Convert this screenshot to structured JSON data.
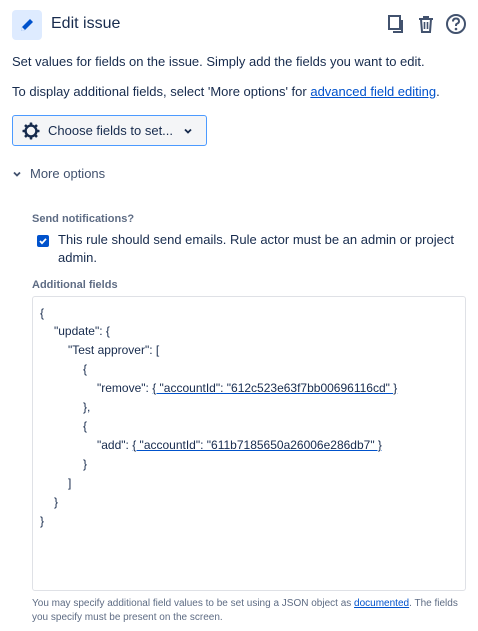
{
  "header": {
    "title": "Edit issue",
    "icons": [
      "pencil-icon",
      "copy-icon",
      "trash-icon",
      "help-icon"
    ]
  },
  "intro": {
    "line1": "Set values for fields on the issue. Simply add the fields you want to edit.",
    "line2_prefix": "To display additional fields, select 'More options' for ",
    "line2_link": "advanced field editing",
    "line2_suffix": "."
  },
  "choose_button": {
    "label": "Choose fields to set..."
  },
  "more_options": {
    "label": "More options"
  },
  "notifications": {
    "label": "Send notifications?",
    "checked": true,
    "text": "This rule should send emails. Rule actor must be an admin or project admin."
  },
  "additional_fields": {
    "label": "Additional fields",
    "json_lines": {
      "l1": "{",
      "l2": "\"update\": {",
      "l3": "\"Test approver\": [",
      "l4": "{",
      "l5_key": "\"remove\": ",
      "l5_val": "{ \"accountId\": \"612c523e63f7bb00696116cd\" }",
      "l6": "},",
      "l7": "{",
      "l8_key": "\"add\": ",
      "l8_val": "{ \"accountId\": \"611b7185650a26006e286db7\" }",
      "l9": "}",
      "l10": "]",
      "l11": "}",
      "l12": "}"
    }
  },
  "hint": {
    "prefix": "You may specify additional field values to be set using a JSON object as ",
    "link": "documented",
    "suffix": ". The fields you specify must be present on the screen."
  },
  "colors": {
    "accent": "#0052cc",
    "text": "#172b4d",
    "muted": "#5e6c84",
    "border": "#dfe1e6"
  }
}
